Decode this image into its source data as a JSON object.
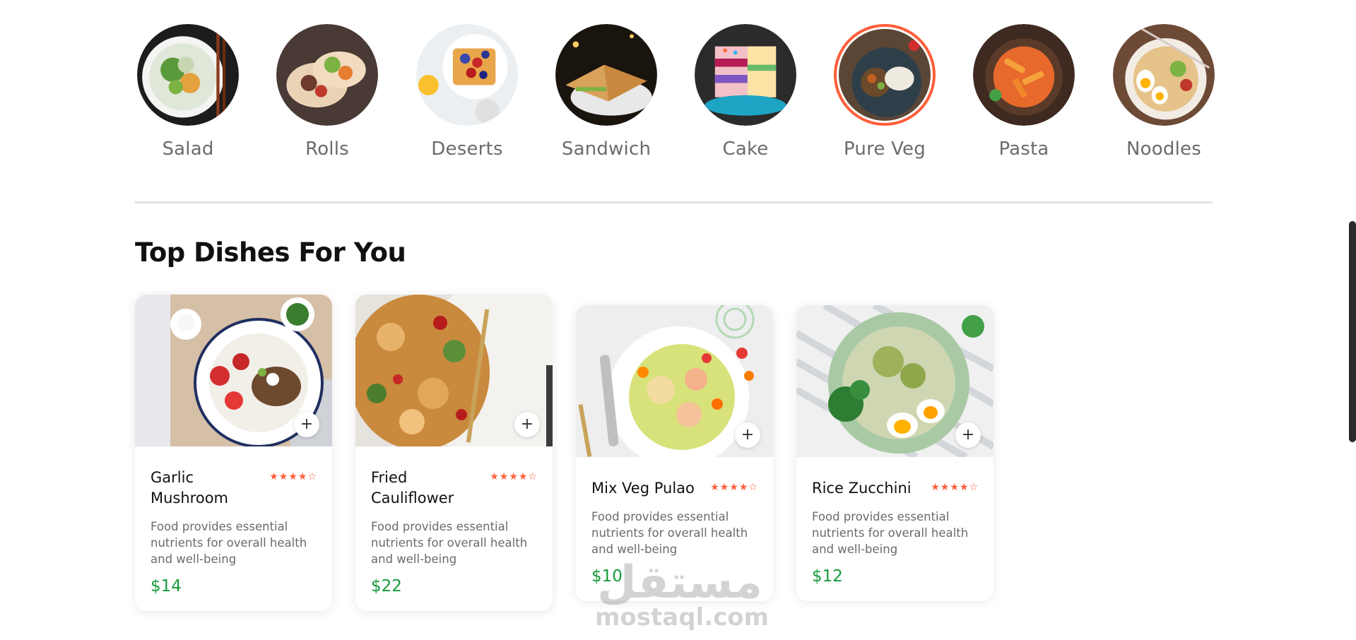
{
  "categories": [
    {
      "label": "Salad",
      "active": false
    },
    {
      "label": "Rolls",
      "active": false
    },
    {
      "label": "Deserts",
      "active": false
    },
    {
      "label": "Sandwich",
      "active": false
    },
    {
      "label": "Cake",
      "active": false
    },
    {
      "label": "Pure Veg",
      "active": true
    },
    {
      "label": "Pasta",
      "active": false
    },
    {
      "label": "Noodles",
      "active": false
    }
  ],
  "section": {
    "title": "Top Dishes For You"
  },
  "dishes": [
    {
      "name": "Garlic Mushroom",
      "rating": 4,
      "description": "Food provides essential nutrients for overall health and well-being",
      "price": "$14"
    },
    {
      "name": "Fried Cauliflower",
      "rating": 4,
      "description": "Food provides essential nutrients for overall health and well-being",
      "price": "$22"
    },
    {
      "name": "Mix Veg Pulao",
      "rating": 4,
      "description": "Food provides essential nutrients for overall health and well-being",
      "price": "$10"
    },
    {
      "name": "Rice Zucchini",
      "rating": 4,
      "description": "Food provides essential nutrients for overall health and well-being",
      "price": "$12"
    }
  ],
  "add_button": {
    "label": "+"
  },
  "watermark": {
    "arabic": "مستقل",
    "latin": "mostaql.com"
  },
  "colors": {
    "accent": "#ff5e3a",
    "price": "#179a3b",
    "muted": "#6b6b6b",
    "divider": "#e2e2e2"
  }
}
